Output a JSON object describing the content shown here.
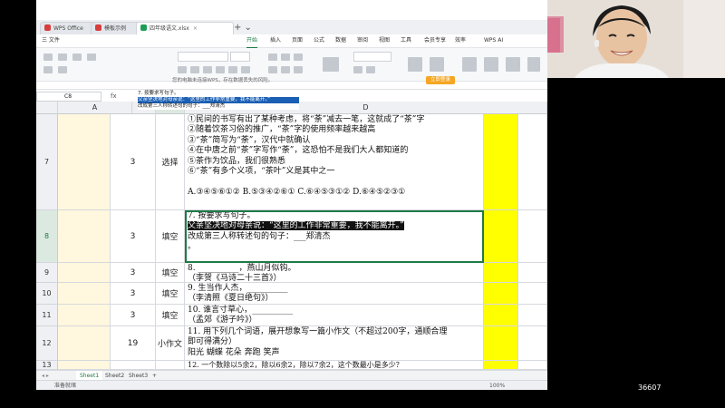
{
  "window": {
    "tabs": [
      {
        "label": "WPS Office",
        "color": "#d63d3d"
      },
      {
        "label": "模板示例",
        "color": "#d63d3d"
      },
      {
        "label": "四年级语文.xlsx",
        "color": "#1f9d55"
      }
    ]
  },
  "menu": {
    "items": [
      "三 文件",
      "开始",
      "插入",
      "页面",
      "公式",
      "数据",
      "审阅",
      "视图",
      "工具",
      "会员专享",
      "效率",
      "WPS AI"
    ],
    "active_index": 1
  },
  "notice": {
    "text": "您的电脑未连接WPS，存在数据丢失的风险。",
    "button": "立即登录"
  },
  "formula_bar": {
    "name_box": "C8",
    "fx_label": "fx",
    "lines": [
      "7. 按要求写句子。",
      "父亲坚决地对母亲说：“这里的工作非常重要，我不能离开。”",
      "改成第三人称转述句的句子：___郑清杰"
    ]
  },
  "columns": [
    "A",
    "B",
    "C",
    "D"
  ],
  "selected_column": "C",
  "rows": [
    {
      "row": "7",
      "num": "3",
      "type": "选择",
      "lines": [
        "①民间的书写有出了某种考虑，将“荼”减去一笔，这就成了“茶”字",
        "②随着饮茶习俗的推广，“茶”字的使用频率越来越高",
        "③“茶”简写为“荼”，汉代中就确认",
        "④在中唐之前“茶”字写作“荼”，这恐怕不是我们大人都知道的",
        "⑤茶作为饮品，我们很熟悉",
        "⑥“茶”有多个义项，“茶叶”义是其中之一",
        "",
        "A.③④⑤⑥①② B.⑤③④②⑥① C.⑥④⑤③①② D.⑥④⑤②③①"
      ]
    },
    {
      "row": "8",
      "num": "3",
      "type": "填空",
      "lines": [
        "7. 按要求写句子。",
        "父亲坚决地对母亲说：“这里的工作非常重要，我不能离开。”",
        "改成第三人称转述句的句子：___郑清杰",
        "。"
      ]
    },
    {
      "row": "9",
      "num": "3",
      "type": "填空",
      "lines": [
        "8. __________，燕山月似钩。",
        "（李贺《马诗二十三首》）"
      ]
    },
    {
      "row": "10",
      "num": "3",
      "type": "填空",
      "lines": [
        "9. 生当作人杰，__________",
        "（李清照《夏日绝句》）"
      ]
    },
    {
      "row": "11",
      "num": "3",
      "type": "填空",
      "lines": [
        "10. 谁言寸草心，__________",
        "（孟郊《游子吟》）"
      ]
    },
    {
      "row": "12",
      "num": "19",
      "type": "小作文",
      "lines": [
        "11. 用下列几个词语，展开想象写一篇小作文（不超过200字，通顺合理",
        "即可得满分）",
        "阳光    蝴蝶    花朵    奔跑    笑声"
      ]
    },
    {
      "row": "13",
      "num": "",
      "type": "",
      "lines": [
        "12. 一个数除以5余2，除以6余2，除以7余2，这个数最小是多少？"
      ]
    }
  ],
  "sheets": {
    "tabs": [
      "Sheet1",
      "Sheet2",
      "Sheet3"
    ],
    "active": "Sheet1"
  },
  "status": {
    "left": "准备就绪",
    "zoom": "100%"
  },
  "overlay": {
    "watermark": "36607"
  },
  "colors": {
    "accent": "#1f7a45",
    "highlight_column": "#ffff00",
    "key_columns": "#fff7de"
  }
}
